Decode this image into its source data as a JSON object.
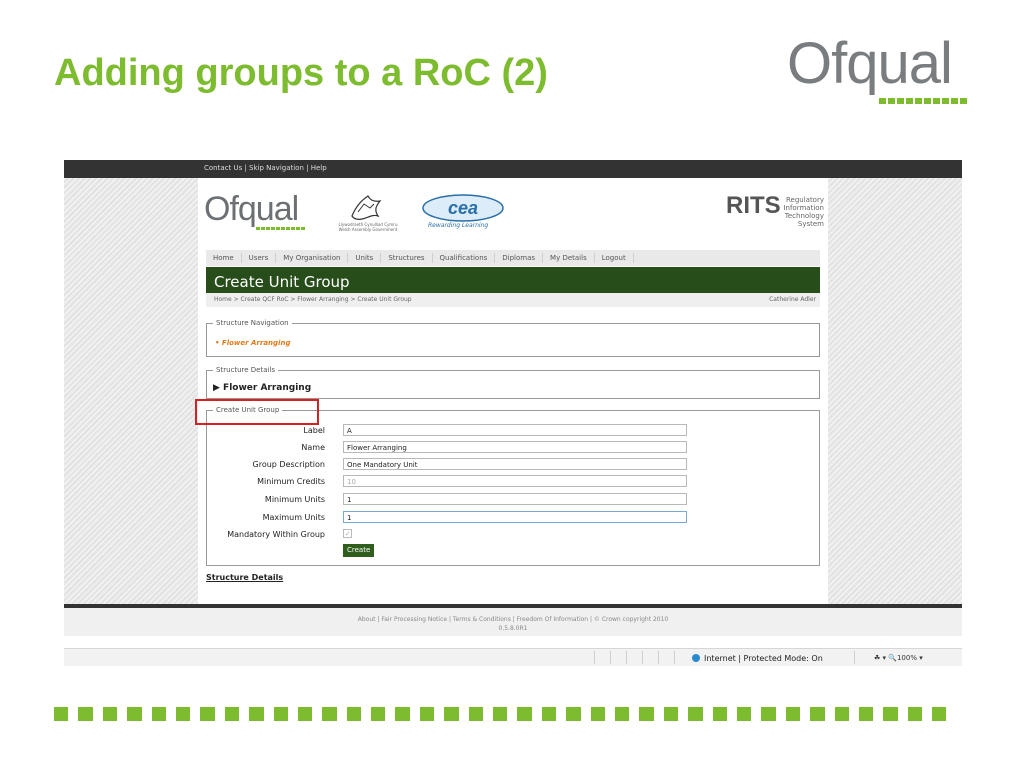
{
  "slide": {
    "title": "Adding groups to a RoC (2)",
    "logo_text": "Ofqual",
    "accent": "#7cbc2e"
  },
  "browser": {
    "top_links": "Contact Us | Skip Navigation | Help",
    "logo_text": "Ofqual",
    "welsh_text": "Llywodraeth Cynulliad Cymru Welsh Assembly Government",
    "cea_tagline": "Rewarding Learning",
    "rits": {
      "title": "RITS",
      "line1": "Regulatory",
      "line2": "Information",
      "line3": "Technology",
      "line4": "System"
    },
    "nav": [
      "Home",
      "Users",
      "My Organisation",
      "Units",
      "Structures",
      "Qualifications",
      "Diplomas",
      "My Details",
      "Logout"
    ],
    "page_title": "Create Unit Group",
    "breadcrumb": "Home > Create QCF RoC > Flower Arranging > Create Unit Group",
    "user": "Catherine Adler",
    "structure_navigation": {
      "legend": "Structure Navigation",
      "item": "Flower Arranging"
    },
    "structure_details": {
      "legend": "Structure Details",
      "heading": "▶ Flower Arranging"
    },
    "create_unit_group": {
      "legend": "Create Unit Group",
      "fields": {
        "label": {
          "label": "Label",
          "value": "A"
        },
        "name": {
          "label": "Name",
          "value": "Flower Arranging"
        },
        "description": {
          "label": "Group Description",
          "value": "One Mandatory Unit"
        },
        "min_credits": {
          "label": "Minimum Credits",
          "value": "10"
        },
        "min_units": {
          "label": "Minimum Units",
          "value": "1"
        },
        "max_units": {
          "label": "Maximum Units",
          "value": "1"
        },
        "mandatory": {
          "label": "Mandatory Within Group",
          "value": "✓"
        }
      },
      "create_button": "Create"
    },
    "structure_details_link": "Structure Details",
    "footer": {
      "line1": "About | Fair Processing Notice | Terms & Conditions | Freedom Of Information | © Crown copyright 2010",
      "line2": "0.5.8.0R1"
    },
    "status_bar": {
      "zone": "Internet | Protected Mode: On",
      "zoom": "☘ ▾  🔍100%  ▾"
    }
  }
}
